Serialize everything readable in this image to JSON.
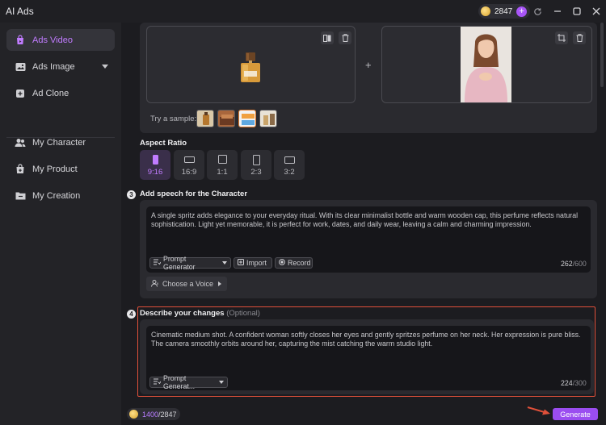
{
  "window": {
    "title": "AI Ads",
    "credits": "2847",
    "add_symbol": "+"
  },
  "sidebar": {
    "items": [
      {
        "label": "Ads Video",
        "icon": "video-bag-icon",
        "active": true
      },
      {
        "label": "Ads Image",
        "icon": "image-icon",
        "has_dropdown": true
      },
      {
        "label": "Ad Clone",
        "icon": "clone-icon"
      },
      {
        "label": "My Character",
        "icon": "users-icon"
      },
      {
        "label": "My Product",
        "icon": "product-bag-icon"
      },
      {
        "label": "My Creation",
        "icon": "folder-icon"
      }
    ]
  },
  "upload": {
    "plus_symbol": "+",
    "try_sample_label": "Try a sample:"
  },
  "aspect_ratio": {
    "title": "Aspect Ratio",
    "options": [
      "9:16",
      "16:9",
      "1:1",
      "2:3",
      "3:2"
    ],
    "selected": "9:16"
  },
  "speech": {
    "step": "3",
    "title": "Add speech for the Character",
    "text": "A single spritz adds elegance to your everyday ritual. With its clear minimalist bottle and warm wooden cap, this perfume reflects natural sophistication. Light yet memorable, it is perfect for work, dates, and daily wear, leaving a calm and charming impression.",
    "prompt_generator_label": "Prompt Generator",
    "import_label": "Import",
    "record_label": "Record",
    "count": "262",
    "max": "/600",
    "choose_voice_label": "Choose a Voice"
  },
  "changes": {
    "step": "4",
    "title": "Describe your changes",
    "optional": "(Optional)",
    "text": "Cinematic medium shot. A confident woman softly closes her eyes and gently spritzes perfume on her neck. Her expression is pure bliss. The camera smoothly orbits around her, capturing the mist catching the warm studio light.",
    "prompt_generator_label": "Prompt Generat...",
    "count": "224",
    "max": "/300"
  },
  "footer": {
    "credits_used": "1400",
    "credits_total": "/2847",
    "generate_label": "Generate"
  },
  "colors": {
    "accent": "#9b4df0",
    "highlight": "#e0503a",
    "background": "#1c1c20"
  }
}
